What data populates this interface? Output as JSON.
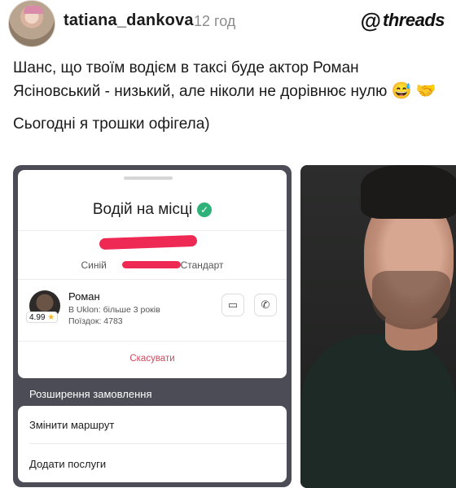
{
  "post": {
    "username": "tatiana_dankova",
    "time": "12 год",
    "brand": "threads",
    "text_line1": "Шанс, що твоїм водієм в таксі буде актор Роман Ясіновський - низький, але ніколи не дорівнює нулю",
    "emoji1": "😅",
    "emoji2": "🤝",
    "text_line2": "Сьогодні я трошки офігела)"
  },
  "app": {
    "title": "Водій на місці",
    "car_prefix": "Синій",
    "car_class": "Стандарт",
    "driver_name": "Роман",
    "driver_exp": "В Uklon: більше 3 років",
    "driver_trips": "Поїздок: 4783",
    "rating": "4.99",
    "cancel_label": "Скасувати",
    "extensions_label": "Розширення замовлення",
    "menu": [
      {
        "label": "Змінити маршрут"
      },
      {
        "label": "Додати послуги"
      }
    ]
  },
  "colors": {
    "accent_green": "#2fb27a",
    "cancel_red": "#d0465c",
    "redaction": "#ee2a54",
    "phone_dark": "#4b4c55"
  },
  "icons": [
    "threads-logo-icon",
    "verified-check-icon",
    "star-icon",
    "cup-icon",
    "phone-chat-icon"
  ]
}
